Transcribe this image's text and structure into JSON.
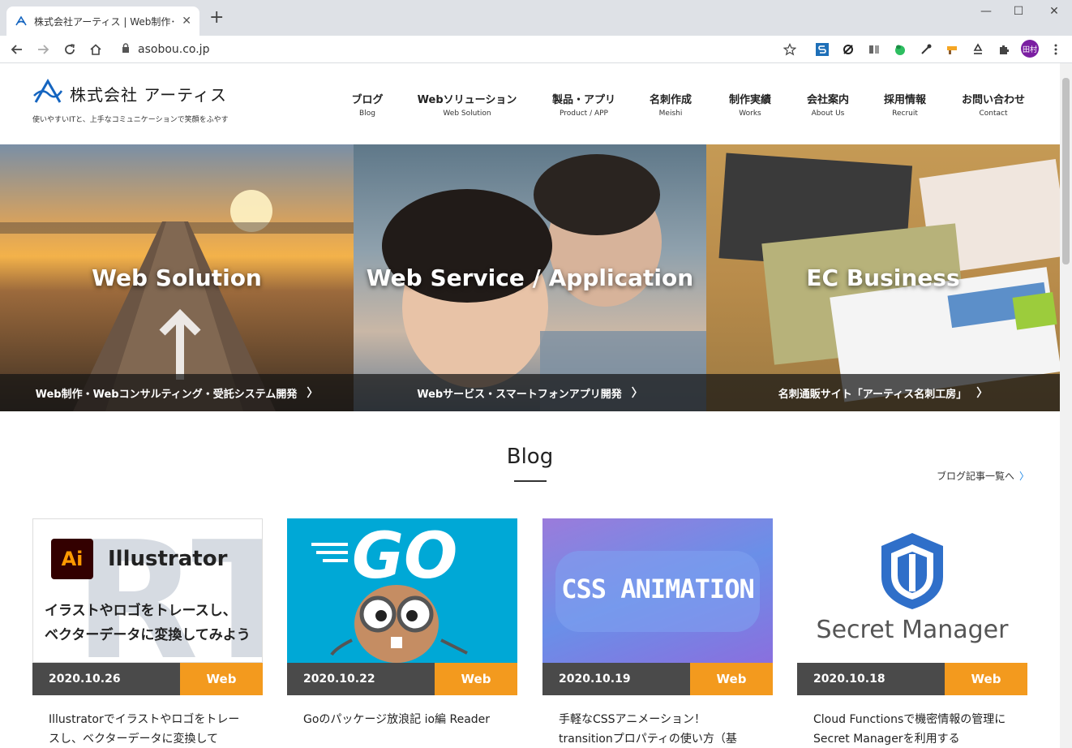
{
  "browser": {
    "tab_title": "株式会社アーティス | Web制作･シス",
    "tab_close": "✕",
    "new_tab": "+",
    "url": "asobou.co.jp",
    "window_controls": [
      "—",
      "☐",
      "✕"
    ],
    "profile_initials": "田村"
  },
  "site": {
    "logo_text": "株式会社 アーティス",
    "tagline": "使いやすいITと、上手なコミュニケーションで笑顔をふやす",
    "brand_color": "#1565c0"
  },
  "nav": [
    {
      "jp": "ブログ",
      "en": "Blog"
    },
    {
      "jp": "Webソリューション",
      "en": "Web Solution"
    },
    {
      "jp": "製品・アプリ",
      "en": "Product / APP"
    },
    {
      "jp": "名刺作成",
      "en": "Meishi"
    },
    {
      "jp": "制作実績",
      "en": "Works"
    },
    {
      "jp": "会社案内",
      "en": "About Us"
    },
    {
      "jp": "採用情報",
      "en": "Recruit"
    },
    {
      "jp": "お問い合わせ",
      "en": "Contact"
    }
  ],
  "hero": [
    {
      "title": "Web Solution",
      "caption": "Web制作・Webコンサルティング・受託システム開発"
    },
    {
      "title": "Web Service / Application",
      "caption": "Webサービス・スマートフォンアプリ開発"
    },
    {
      "title": "EC Business",
      "caption": "名刺通販サイト「アーティス名刺工房」"
    }
  ],
  "hero_chevron": "〉",
  "blog": {
    "heading": "Blog",
    "more_link": "ブログ記事一覧へ",
    "more_arrow": "〉",
    "accent_color": "#f39a1e",
    "cards": [
      {
        "date": "2020.10.26",
        "category": "Web",
        "title": "Illustratorでイラストやロゴをトレースし、ベクターデータに変換して",
        "thumb": {
          "badge": "Ai",
          "heading": "Illustrator",
          "line1": "イラストやロゴをトレースし、",
          "line2": "ベクターデータに変換してみよう"
        }
      },
      {
        "date": "2020.10.22",
        "category": "Web",
        "title": "Goのパッケージ放浪記 io編 Reader",
        "thumb": {
          "heading": "GO"
        }
      },
      {
        "date": "2020.10.19",
        "category": "Web",
        "title": "手軽なCSSアニメーション！ transitionプロパティの使い方（基",
        "thumb": {
          "heading": "CSS ANIMATION"
        }
      },
      {
        "date": "2020.10.18",
        "category": "Web",
        "title": "Cloud Functionsで機密情報の管理にSecret Managerを利用する",
        "thumb": {
          "heading": "Secret Manager"
        }
      }
    ]
  }
}
